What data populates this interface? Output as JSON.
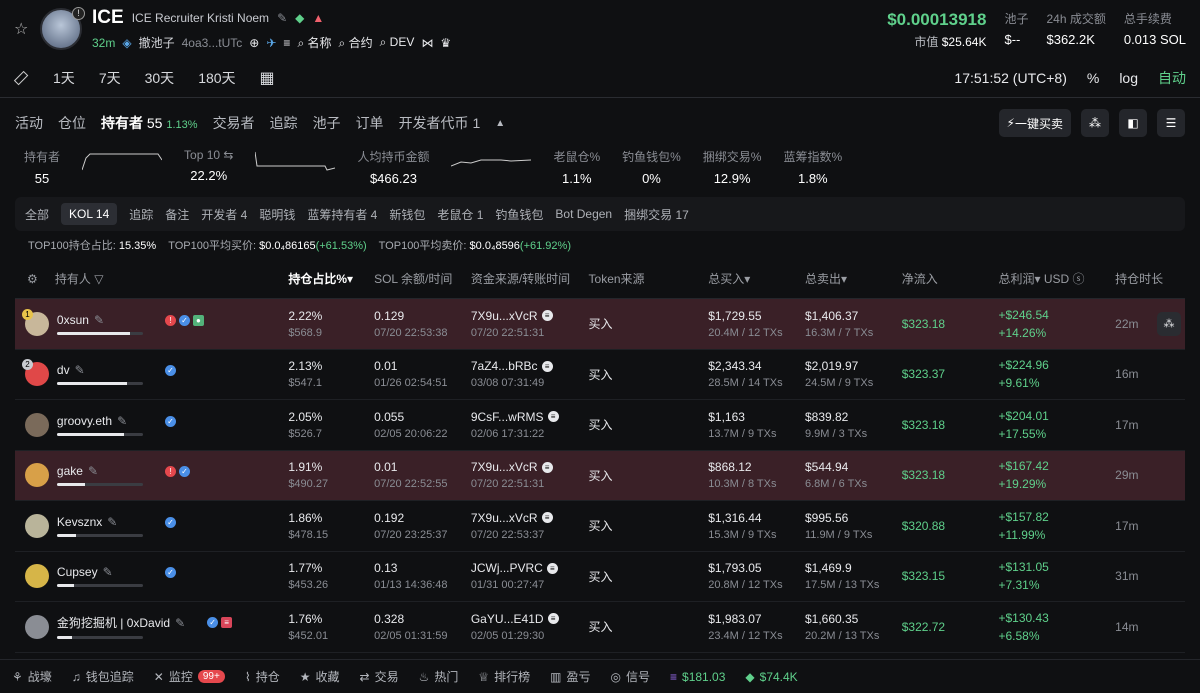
{
  "token": {
    "symbol": "ICE",
    "name": "ICE Recruiter Kristi Noem",
    "age": "32m",
    "pool_label": "撤池子",
    "address": "4oa3...tUTc",
    "links": [
      "名称",
      "合约",
      "DEV"
    ],
    "price": "$0.00013918",
    "mcap_label": "市值",
    "mcap": "$25.64K",
    "stats": [
      {
        "label": "池子",
        "value": "$--"
      },
      {
        "label": "24h 成交额",
        "value": "$362.2K"
      },
      {
        "label": "总手续费",
        "value": "0.013 SOL"
      }
    ]
  },
  "toolbar": {
    "timeframes": [
      "1天",
      "7天",
      "30天",
      "180天"
    ],
    "time": "17:51:52 (UTC+8)",
    "percent": "%",
    "log": "log",
    "auto": "自动"
  },
  "tabs": [
    {
      "label": "活动"
    },
    {
      "label": "仓位"
    },
    {
      "label": "持有者",
      "count": "55",
      "delta": "1.13%"
    },
    {
      "label": "交易者"
    },
    {
      "label": "追踪"
    },
    {
      "label": "池子"
    },
    {
      "label": "订单"
    },
    {
      "label": "开发者代币",
      "count": "1"
    }
  ],
  "quick_buy": "一键买卖",
  "summary": [
    {
      "label": "持有者",
      "value": "55"
    },
    {
      "label": "Top 10 ⇆",
      "value": "22.2%"
    },
    {
      "label": "人均持币金额",
      "value": "$466.23"
    },
    {
      "label": "老鼠仓%",
      "value": "1.1%"
    },
    {
      "label": "钓鱼钱包%",
      "value": "0%"
    },
    {
      "label": "捆绑交易%",
      "value": "12.9%"
    },
    {
      "label": "蓝筹指数%",
      "value": "1.8%"
    }
  ],
  "filters": [
    "全部",
    "KOL 14",
    "追踪",
    "备注",
    "开发者 4",
    "聪明钱",
    "蓝筹持有者 4",
    "新钱包",
    "老鼠仓 1",
    "钓鱼钱包",
    "Bot Degen",
    "捆绑交易 17"
  ],
  "top100": {
    "ratio_label": "TOP100持仓占比:",
    "ratio": "15.35%",
    "avg_buy_label": "TOP100平均买价:",
    "avg_buy": "$0.0₄86165",
    "avg_buy_delta": "(+61.53%)",
    "avg_sell_label": "TOP100平均卖价:",
    "avg_sell": "$0.0₄8596",
    "avg_sell_delta": "(+61.92%)"
  },
  "columns": [
    "持有人",
    "持仓占比%",
    "SOL 余额/时间",
    "资金来源/转账时间",
    "Token来源",
    "总买入",
    "总卖出",
    "净流入",
    "总利润",
    "USD",
    "持仓时长"
  ],
  "rows": [
    {
      "name": "0xsun",
      "pct": "2.22%",
      "usd": "$568.9",
      "sol": "0.129",
      "sol_time": "07/20 22:53:38",
      "src": "7X9u...xVcR",
      "src_time": "07/20 22:51:31",
      "token_src": "买入",
      "buy": "$1,729.55",
      "buy_sub": "20.4M / 12 TXs",
      "sell": "$1,406.37",
      "sell_sub": "16.3M / 7 TXs",
      "net": "$323.18",
      "profit": "+$246.54",
      "profit_pct": "+14.26%",
      "dur": "22m",
      "fill": 0.85,
      "rank": "1",
      "av": "#c8b79a",
      "hl": true
    },
    {
      "name": "dv",
      "pct": "2.13%",
      "usd": "$547.1",
      "sol": "0.01",
      "sol_time": "01/26 02:54:51",
      "src": "7aZ4...bRBc",
      "src_time": "03/08 07:31:49",
      "token_src": "买入",
      "buy": "$2,343.34",
      "buy_sub": "28.5M / 14 TXs",
      "sell": "$2,019.97",
      "sell_sub": "24.5M / 9 TXs",
      "net": "$323.37",
      "profit": "+$224.96",
      "profit_pct": "+9.61%",
      "dur": "16m",
      "fill": 0.82,
      "rank": "2",
      "av": "#e04848",
      "hl": false
    },
    {
      "name": "groovy.eth",
      "pct": "2.05%",
      "usd": "$526.7",
      "sol": "0.055",
      "sol_time": "02/05 20:06:22",
      "src": "9CsF...wRMS",
      "src_time": "02/06 17:31:22",
      "token_src": "买入",
      "buy": "$1,163",
      "buy_sub": "13.7M / 9 TXs",
      "sell": "$839.82",
      "sell_sub": "9.9M / 3 TXs",
      "net": "$323.18",
      "profit": "+$204.01",
      "profit_pct": "+17.55%",
      "dur": "17m",
      "fill": 0.78,
      "rank": "",
      "av": "#7a6a5a",
      "hl": false
    },
    {
      "name": "gake",
      "pct": "1.91%",
      "usd": "$490.27",
      "sol": "0.01",
      "sol_time": "07/20 22:52:55",
      "src": "7X9u...xVcR",
      "src_time": "07/20 22:51:31",
      "token_src": "买入",
      "buy": "$868.12",
      "buy_sub": "10.3M / 8 TXs",
      "sell": "$544.94",
      "sell_sub": "6.8M / 6 TXs",
      "net": "$323.18",
      "profit": "+$167.42",
      "profit_pct": "+19.29%",
      "dur": "29m",
      "fill": 0.33,
      "rank": "",
      "av": "#d8a048",
      "hl": true
    },
    {
      "name": "Kevsznx",
      "pct": "1.86%",
      "usd": "$478.15",
      "sol": "0.192",
      "sol_time": "07/20 23:25:37",
      "src": "7X9u...xVcR",
      "src_time": "07/20 22:53:37",
      "token_src": "买入",
      "buy": "$1,316.44",
      "buy_sub": "15.3M / 9 TXs",
      "sell": "$995.56",
      "sell_sub": "11.9M / 9 TXs",
      "net": "$320.88",
      "profit": "+$157.82",
      "profit_pct": "+11.99%",
      "dur": "17m",
      "fill": 0.22,
      "rank": "",
      "av": "#b9b49a",
      "hl": false
    },
    {
      "name": "Cupsey",
      "pct": "1.77%",
      "usd": "$453.26",
      "sol": "0.13",
      "sol_time": "01/13 14:36:48",
      "src": "JCWj...PVRC",
      "src_time": "01/31 00:27:47",
      "token_src": "买入",
      "buy": "$1,793.05",
      "buy_sub": "20.8M / 12 TXs",
      "sell": "$1,469.9",
      "sell_sub": "17.5M / 13 TXs",
      "net": "$323.15",
      "profit": "+$131.05",
      "profit_pct": "+7.31%",
      "dur": "31m",
      "fill": 0.2,
      "rank": "",
      "av": "#d6b548",
      "hl": false
    },
    {
      "name": "金狗挖掘机 | 0xDavid",
      "pct": "1.76%",
      "usd": "$452.01",
      "sol": "0.328",
      "sol_time": "02/05 01:31:59",
      "src": "GaYU...E41D",
      "src_time": "02/05 01:29:30",
      "token_src": "买入",
      "buy": "$1,983.07",
      "buy_sub": "23.4M / 12 TXs",
      "sell": "$1,660.35",
      "sell_sub": "20.2M / 13 TXs",
      "net": "$322.72",
      "profit": "+$130.43",
      "profit_pct": "+6.58%",
      "dur": "14m",
      "fill": 0.18,
      "rank": "",
      "av": "#8a8d94",
      "hl": false
    }
  ],
  "footer": {
    "items": [
      "战壕",
      "钱包追踪",
      "监控",
      "持仓",
      "收藏",
      "交易",
      "热门",
      "排行榜",
      "盈亏",
      "信号"
    ],
    "badge": "99+",
    "sol_price": "$181.03",
    "other_price": "$74.4K"
  }
}
